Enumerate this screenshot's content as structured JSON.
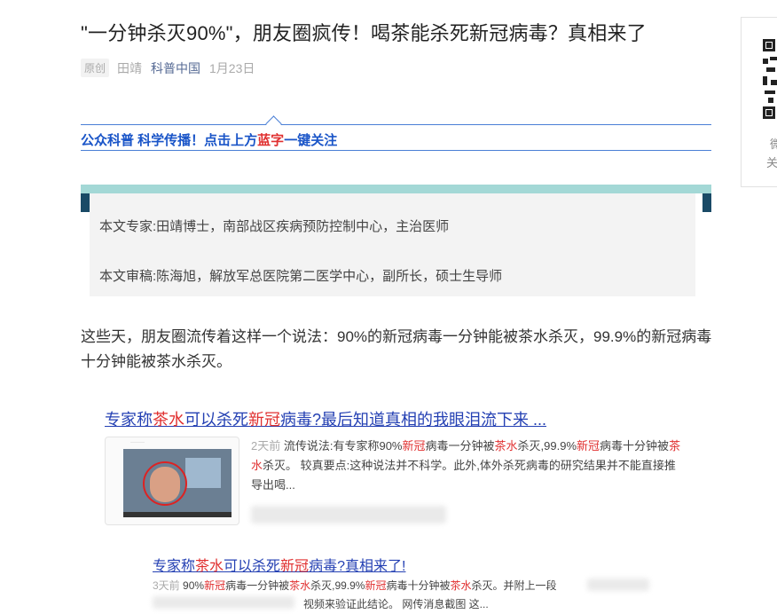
{
  "article": {
    "title": "\"一分钟杀灭90%\"，朋友圈疯传！喝茶能杀死新冠病毒？真相来了",
    "original_tag": "原创",
    "author": "田靖",
    "account": "科普中国",
    "date": "1月23日"
  },
  "banner": {
    "text_part1": "公众科普 科学传播！点击上方",
    "text_highlight": "蓝字",
    "text_part2": "一键关注"
  },
  "expert_box": {
    "expert_line": "本文专家:田靖博士，南部战区疾病预防控制中心，主治医师",
    "reviewer_line": "本文审稿:陈海旭，解放军总医院第二医学中心，副所长，硕士生导师"
  },
  "body": {
    "paragraph1": "这些天，朋友圈流传着这样一个说法：90%的新冠病毒一分钟能被茶水杀灭，99.9%的新冠病毒十分钟能被茶水杀灭。"
  },
  "search_result_1": {
    "title_parts": [
      "专家称",
      "茶水",
      "可以杀死",
      "新冠",
      "病毒?最后知道真相的我眼泪流下来  ..."
    ],
    "snippet_time": "2天前",
    "snippet_parts": [
      "流传说法:有专家称90%",
      "新冠",
      "病毒一分钟被",
      "茶水",
      "杀灭,99.9%",
      "新冠",
      "病毒十分钟被",
      "茶水",
      "杀灭。 较真要点:这种说法并不科学。此外,体外杀死病毒的研究结果并不能直接推导出喝..."
    ]
  },
  "search_result_2": {
    "title_parts": [
      "专家称",
      "茶水",
      "可以杀死",
      "新冠",
      "病毒?真相来了!"
    ],
    "snippet_time": "3天前",
    "snippet_parts": [
      "90%",
      "新冠",
      "病毒一分钟被",
      "茶水",
      "杀灭,99.9%",
      "新冠",
      "病毒十分钟被",
      "茶水",
      "杀灭。并附上一段"
    ],
    "snippet_line2": "视频来验证此结论。 网传消息截图 这..."
  },
  "qr_panel": {
    "label1": "微",
    "label2": "关"
  },
  "colors": {
    "link_blue": "#2440b3",
    "highlight_red": "#e03030",
    "banner_blue": "#1a55c8",
    "teal": "#a3d8d6"
  }
}
